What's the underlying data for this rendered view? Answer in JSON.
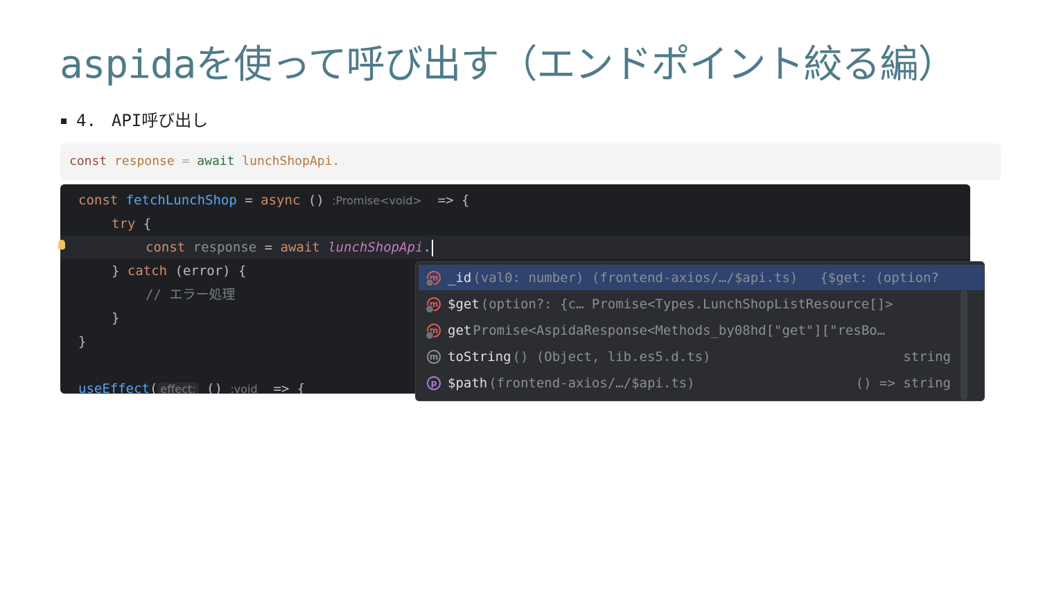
{
  "slide": {
    "title": "aspidaを使って呼び出す（エンドポイント絞る編）",
    "bullet": {
      "number": "4.",
      "text": "API呼び出し"
    }
  },
  "snippet": {
    "kw_const": "const",
    "var": "response",
    "op": "=",
    "kw_await": "await",
    "obj": "lunchShopApi."
  },
  "ide": {
    "line1": {
      "const": "const",
      "fn": "fetchLunchShop",
      "eq": " = ",
      "async": "async",
      "parens": " () ",
      "hint": ":Promise<void>",
      "arrow": "  => {"
    },
    "line2": {
      "try": "try",
      "brace": " {"
    },
    "line3": {
      "const": "const",
      "var": "response",
      "eq": " = ",
      "await": "await",
      "obj": "lunchShopApi",
      "dot": "."
    },
    "line4": {
      "brace": "} ",
      "catch": "catch",
      "rest": " (error) {"
    },
    "line5": {
      "comment": "// エラー処理"
    },
    "line6": {
      "brace": "}"
    },
    "line7": {
      "brace": "}"
    },
    "line8": {
      "fn": "useEffect",
      "paren": "(",
      "hint_box": "effect:",
      "rest": " () ",
      "hint": ":void",
      "arrow": "  => {"
    }
  },
  "completion": {
    "items": [
      {
        "icon": "m",
        "name": "_id",
        "detail": "(val0: number) (frontend-axios/…/$api.ts)",
        "type": "{$get: (option?"
      },
      {
        "icon": "m",
        "name": "$get",
        "detail": "(option?: {c… Promise<Types.LunchShopListResource[]>",
        "type": ""
      },
      {
        "icon": "m",
        "name": "get",
        "detail": " Promise<AspidaResponse<Methods_by08hd[\"get\"][\"resBo…",
        "type": ""
      },
      {
        "icon": "m",
        "name": "toString",
        "detail": "() (Object, lib.es5.d.ts)",
        "type": "string"
      },
      {
        "icon": "p",
        "name": "$path",
        "detail": " (frontend-axios/…/$api.ts)",
        "type": "() => string"
      }
    ]
  },
  "colors": {
    "title": "#4f7b8a",
    "ide_bg": "#1e1f22",
    "selected_row": "#2e436e",
    "keyword": "#cf8e6d",
    "function": "#56a8f5"
  }
}
